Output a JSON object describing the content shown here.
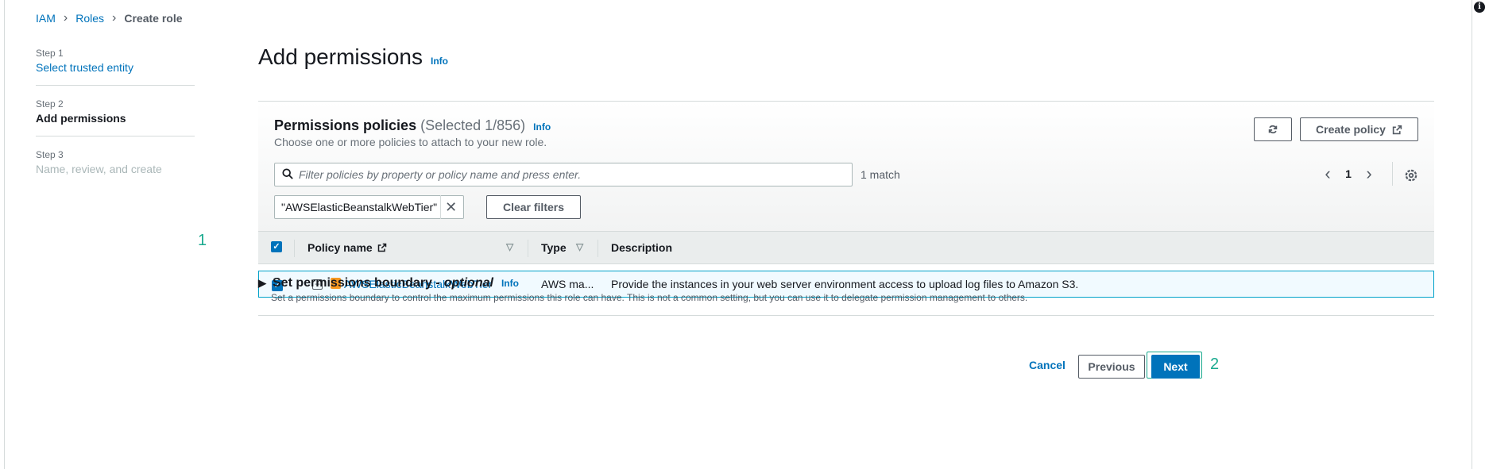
{
  "breadcrumb": {
    "items": [
      "IAM",
      "Roles"
    ],
    "current": "Create role"
  },
  "steps": [
    {
      "num": "Step 1",
      "label": "Select trusted entity"
    },
    {
      "num": "Step 2",
      "label": "Add permissions"
    },
    {
      "num": "Step 3",
      "label": "Name, review, and create"
    }
  ],
  "page": {
    "title": "Add permissions",
    "info": "Info"
  },
  "policies": {
    "title": "Permissions policies",
    "count": "(Selected 1/856)",
    "info": "Info",
    "description": "Choose one or more policies to attach to your new role.",
    "create_policy_label": "Create policy",
    "search_placeholder": "Filter policies by property or policy name and press enter.",
    "match_text": "1 match",
    "page_number": "1",
    "filter_token": "\"AWSElasticBeanstalkWebTier\"",
    "clear_filters_label": "Clear filters",
    "columns": {
      "name": "Policy name",
      "type": "Type",
      "description": "Description"
    },
    "rows": [
      {
        "name": "AWSElasticBeanstalkWebTier",
        "type": "AWS ma...",
        "description": "Provide the instances in your web server environment access to upload log files to Amazon S3."
      }
    ]
  },
  "boundary": {
    "title": "Set permissions boundary -",
    "optional": "optional",
    "info": "Info",
    "description": "Set a permissions boundary to control the maximum permissions this role can have. This is not a common setting, but you can use it to delegate permission management to others."
  },
  "footer": {
    "cancel": "Cancel",
    "previous": "Previous",
    "next": "Next"
  },
  "annotations": {
    "one": "1",
    "two": "2"
  },
  "colors": {
    "accent": "#0073bb",
    "annotation": "#1aaa8f"
  }
}
